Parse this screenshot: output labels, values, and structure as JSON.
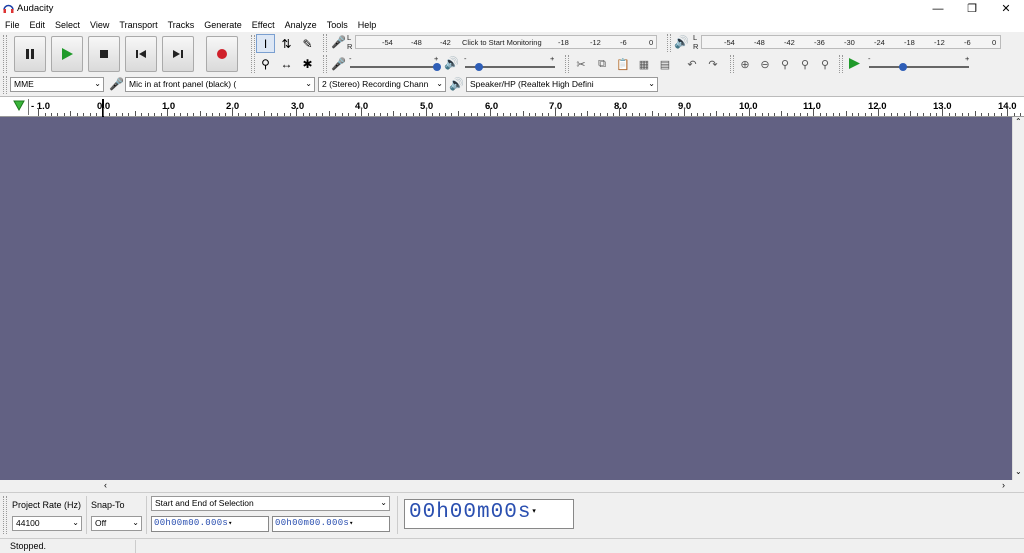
{
  "window": {
    "title": "Audacity"
  },
  "menu": [
    "File",
    "Edit",
    "Select",
    "View",
    "Transport",
    "Tracks",
    "Generate",
    "Effect",
    "Analyze",
    "Tools",
    "Help"
  ],
  "transport": [
    "pause-button",
    "play-button",
    "stop-button",
    "skip-start-button",
    "skip-end-button",
    "record-button"
  ],
  "recording_meter": {
    "scale": [
      "-54",
      "-48",
      "-42",
      "Click to Start Monitoring",
      "-18",
      "-12",
      "-6",
      "0"
    ]
  },
  "playback_meter": {
    "scale": [
      "-54",
      "-48",
      "-42",
      "-36",
      "-30",
      "-24",
      "-18",
      "-12",
      "-6",
      "0"
    ]
  },
  "lr": {
    "l": "L",
    "r": "R"
  },
  "mixer": {
    "minus": "-",
    "plus": "+"
  },
  "device": {
    "host": "MME",
    "input": "Mic in at front panel (black) (",
    "channels": "2 (Stereo) Recording Chann",
    "output": "Speaker/HP (Realtek High Defini"
  },
  "ruler": {
    "labels": [
      "- 1.0",
      "0.0",
      "1.0",
      "2.0",
      "3.0",
      "4.0",
      "5.0",
      "6.0",
      "7.0",
      "8.0",
      "9.0",
      "10.0",
      "11.0",
      "12.0",
      "13.0",
      "14.0"
    ]
  },
  "selection": {
    "rate_label": "Project Rate (Hz)",
    "rate_value": "44100",
    "snap_label": "Snap-To",
    "snap_value": "Off",
    "mode": "Start and End of Selection",
    "start": "00h00m00.000s",
    "end": "00h00m00.000s",
    "audio_position": "00h00m00s"
  },
  "status": {
    "text": "Stopped."
  }
}
